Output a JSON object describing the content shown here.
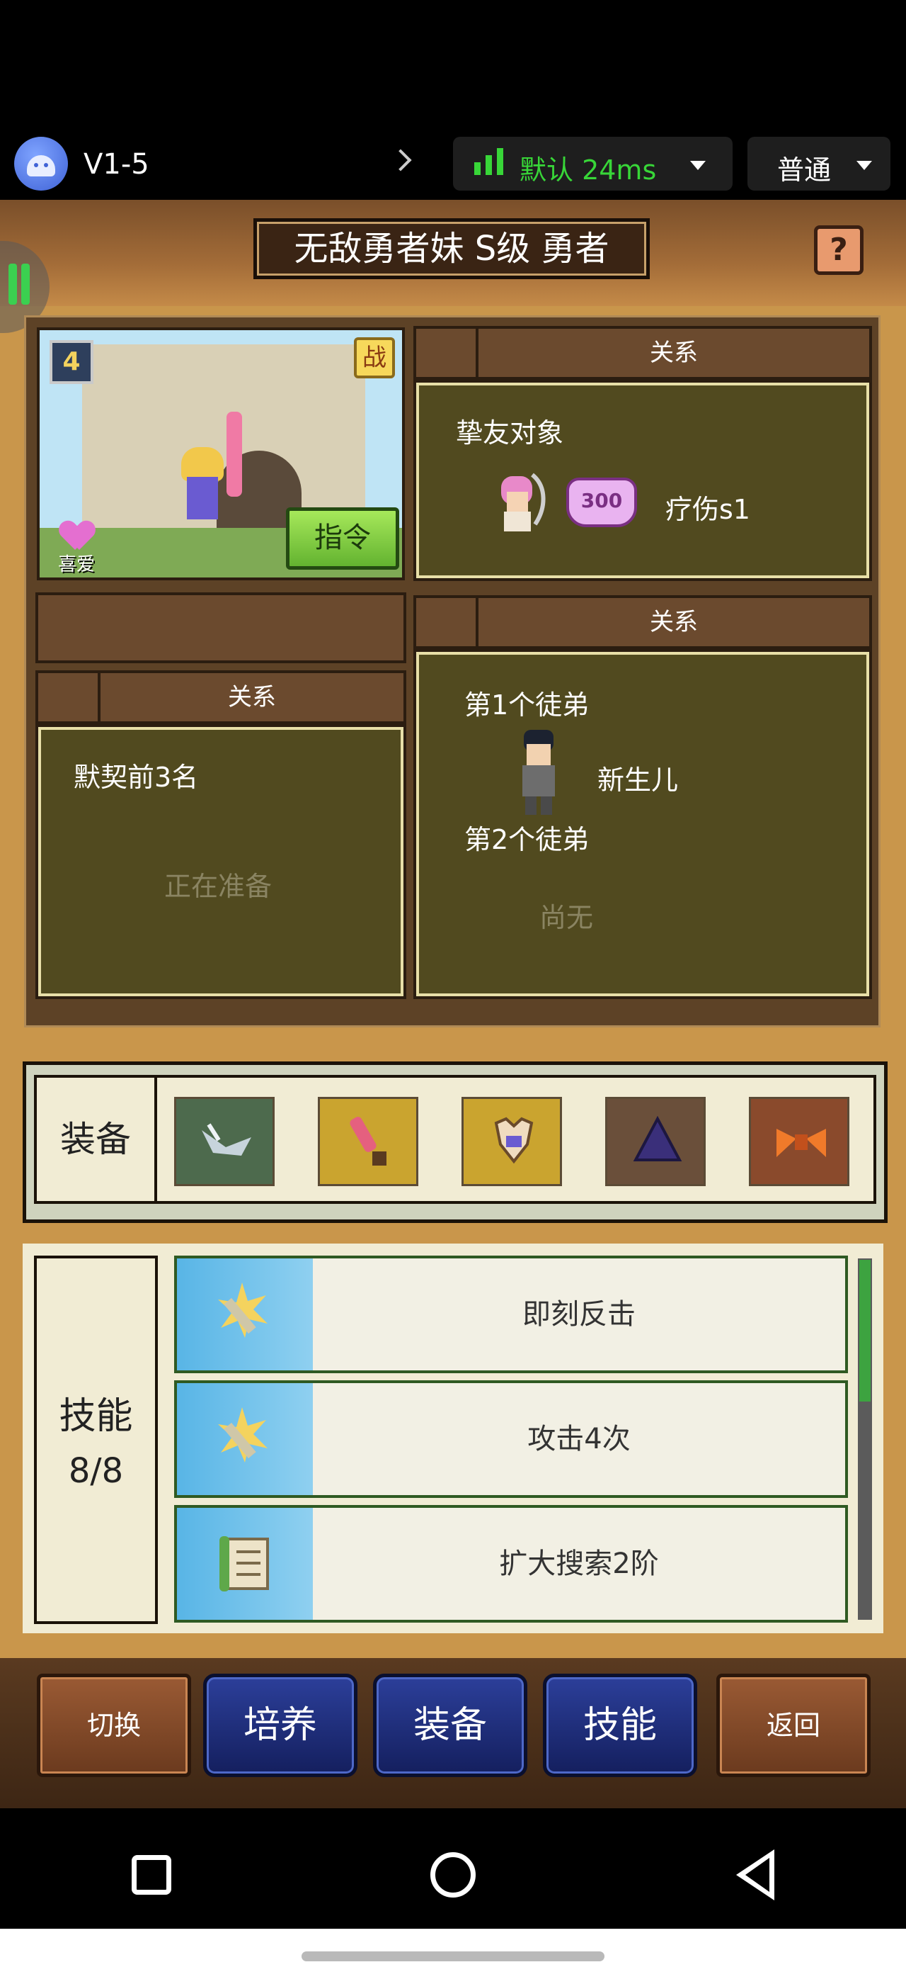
{
  "topbar": {
    "version": "V1-5",
    "network_label": "默认 24ms",
    "mode_label": "普通",
    "colors": {
      "network": "#38d638"
    }
  },
  "game": {
    "title": "无敌勇者妹 S级 勇者",
    "help_label": "?",
    "portrait": {
      "level": "4",
      "battle_label": "战",
      "like_label": "喜爱",
      "command_label": "指令"
    },
    "relations": {
      "friend": {
        "header": "关系",
        "title": "挚友对象",
        "badge": "300",
        "value": "疗伤s1"
      },
      "contract": {
        "header": "关系",
        "title": "默契前3名",
        "status": "正在准备"
      },
      "apprentice": {
        "header": "关系",
        "first_label": "第1个徒弟",
        "first_name": "新生儿",
        "second_label": "第2个徒弟",
        "second_status": "尚无"
      }
    },
    "equipment": {
      "label": "装备",
      "slots": [
        "wing-icon",
        "sword-icon",
        "armor-icon",
        "helmet-icon",
        "ribbon-icon"
      ]
    },
    "skills": {
      "label": "技能",
      "count": "8/8",
      "items": [
        {
          "name": "即刻反击",
          "icon": "spark-sword-icon"
        },
        {
          "name": "攻击4次",
          "icon": "spark-sword-icon"
        },
        {
          "name": "扩大搜索2阶",
          "icon": "scroll-icon"
        }
      ]
    },
    "buttons": {
      "switch": "切换",
      "train": "培养",
      "equip": "装备",
      "skill": "技能",
      "back": "返回"
    }
  }
}
